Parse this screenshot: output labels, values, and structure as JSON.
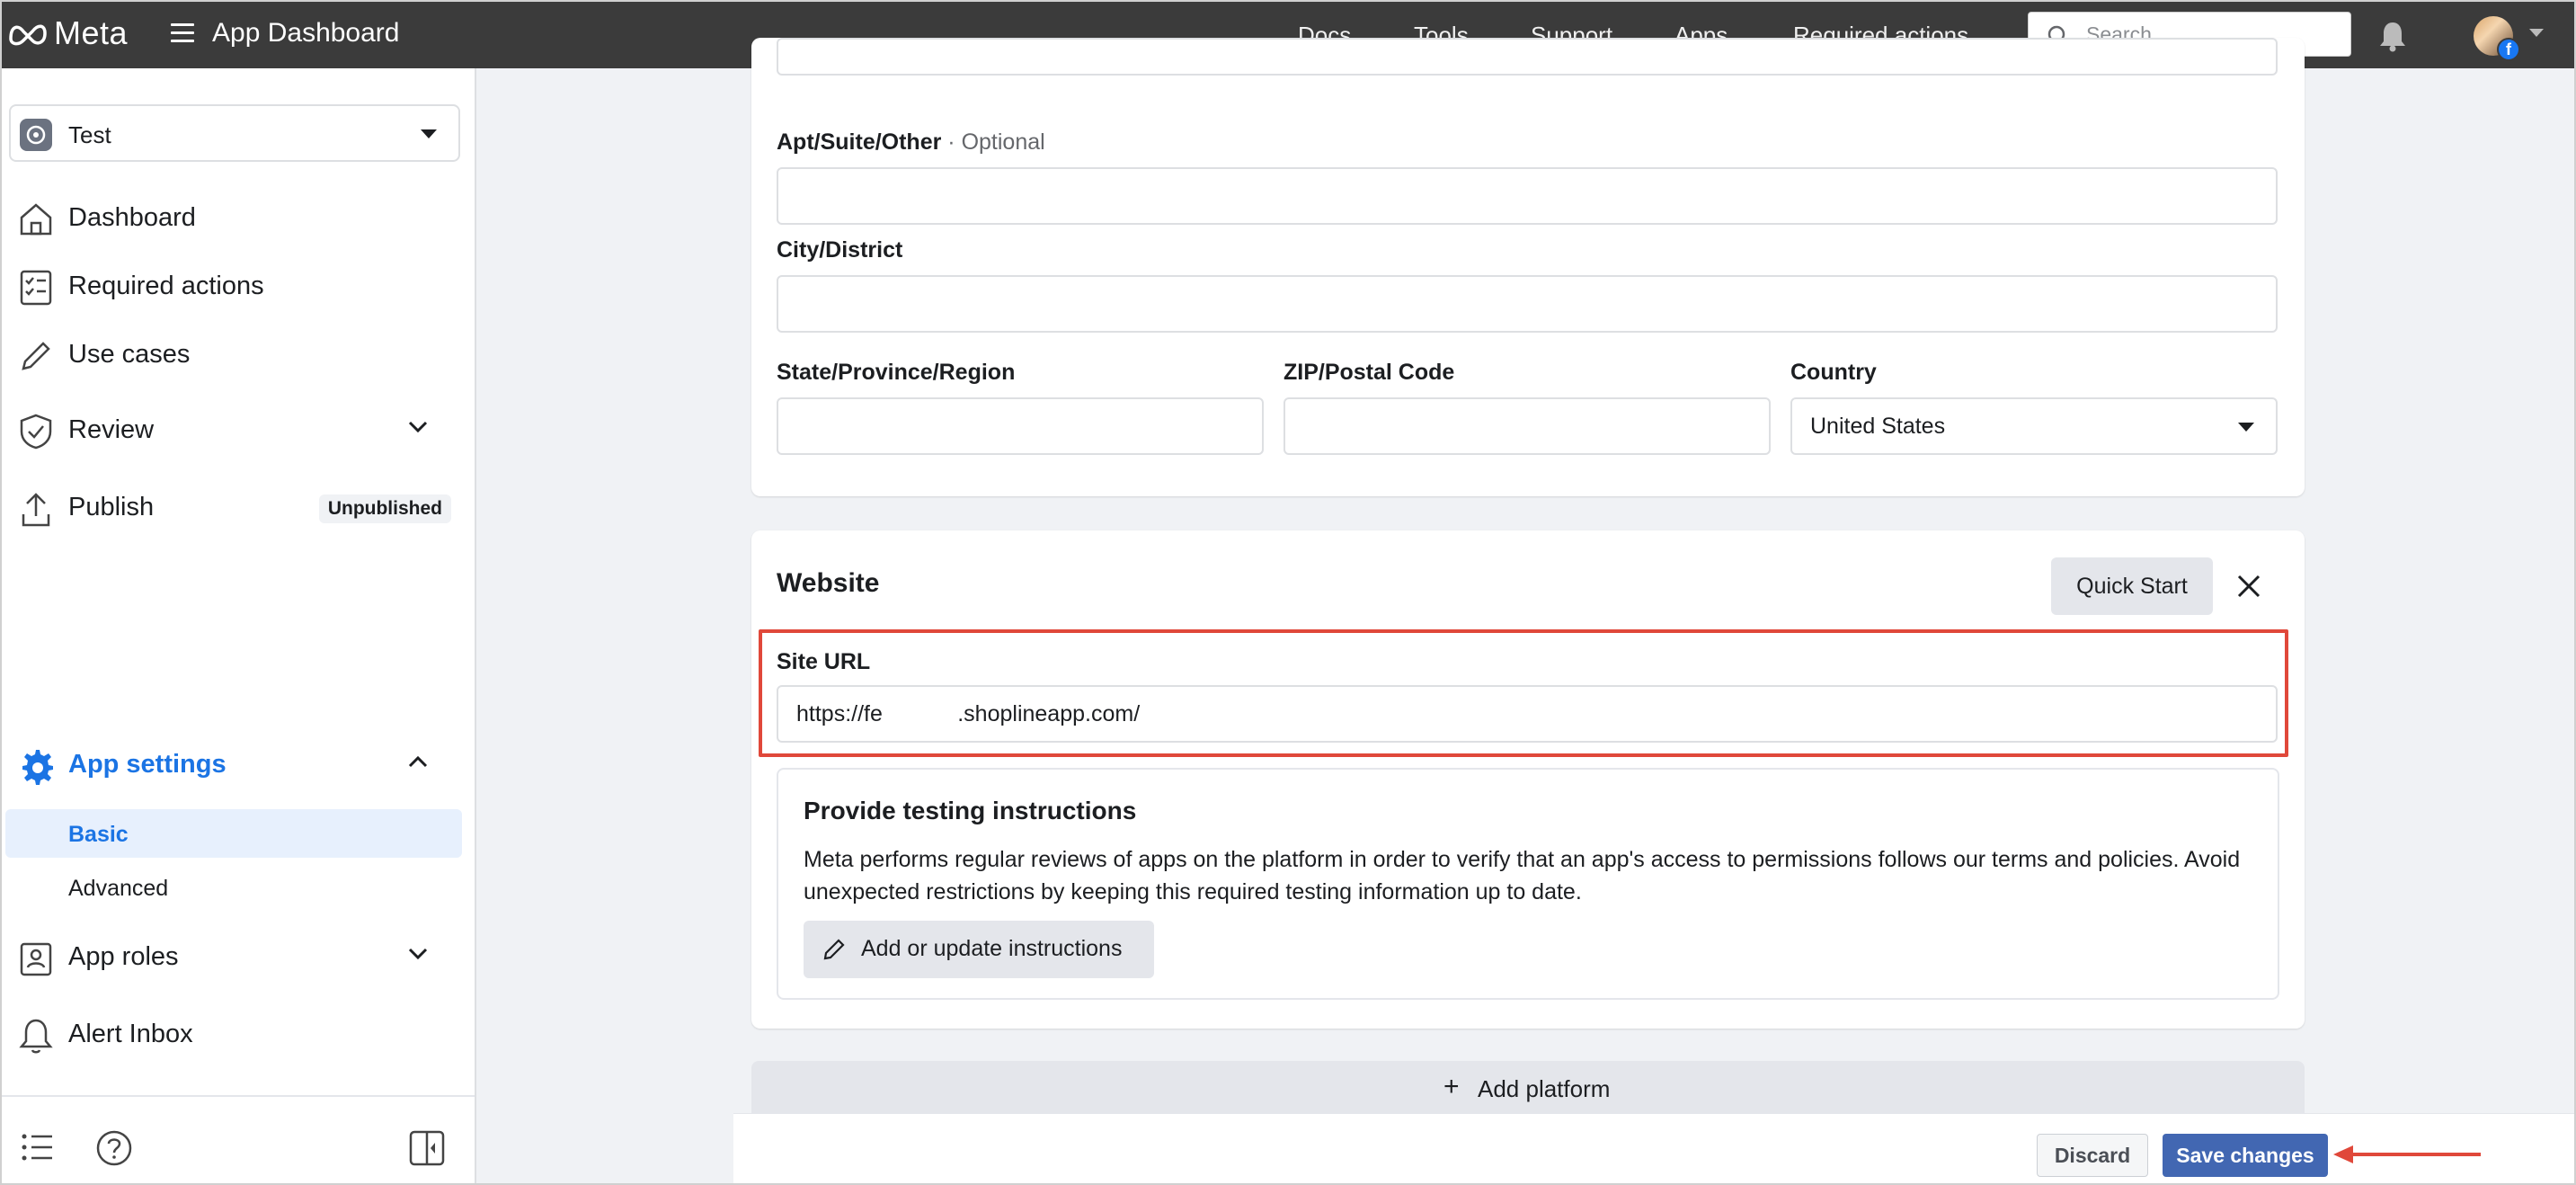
{
  "topbar": {
    "logo": "Meta",
    "app_title": "App Dashboard",
    "nav": [
      "Docs",
      "Tools",
      "Support",
      "Apps",
      "Required actions"
    ],
    "search_placeholder": "Search"
  },
  "sidebar": {
    "app_name": "Test",
    "items": {
      "dashboard": "Dashboard",
      "required_actions": "Required actions",
      "use_cases": "Use cases",
      "review": "Review",
      "publish": "Publish",
      "publish_badge": "Unpublished",
      "app_settings": "App settings",
      "basic": "Basic",
      "advanced": "Advanced",
      "app_roles": "App roles",
      "alert_inbox": "Alert Inbox"
    }
  },
  "address": {
    "apt_label": "Apt/Suite/Other",
    "apt_optional": "· Optional",
    "city_label": "City/District",
    "state_label": "State/Province/Region",
    "zip_label": "ZIP/Postal Code",
    "country_label": "Country",
    "country_value": "United States"
  },
  "website": {
    "title": "Website",
    "quick_start": "Quick Start",
    "site_url_label": "Site URL",
    "site_url_value": "https://fe            .shoplineapp.com/"
  },
  "testing": {
    "title": "Provide testing instructions",
    "description": "Meta performs regular reviews of apps on the platform in order to verify that an app's access to permissions follows our terms and policies. Avoid unexpected restrictions by keeping this required testing information up to date.",
    "button": "Add or update instructions"
  },
  "add_platform": "Add platform",
  "footer": {
    "discard": "Discard",
    "save": "Save changes"
  },
  "colors": {
    "accent": "#1b74e4",
    "save_button": "#4267b2",
    "highlight": "#e0483a"
  }
}
